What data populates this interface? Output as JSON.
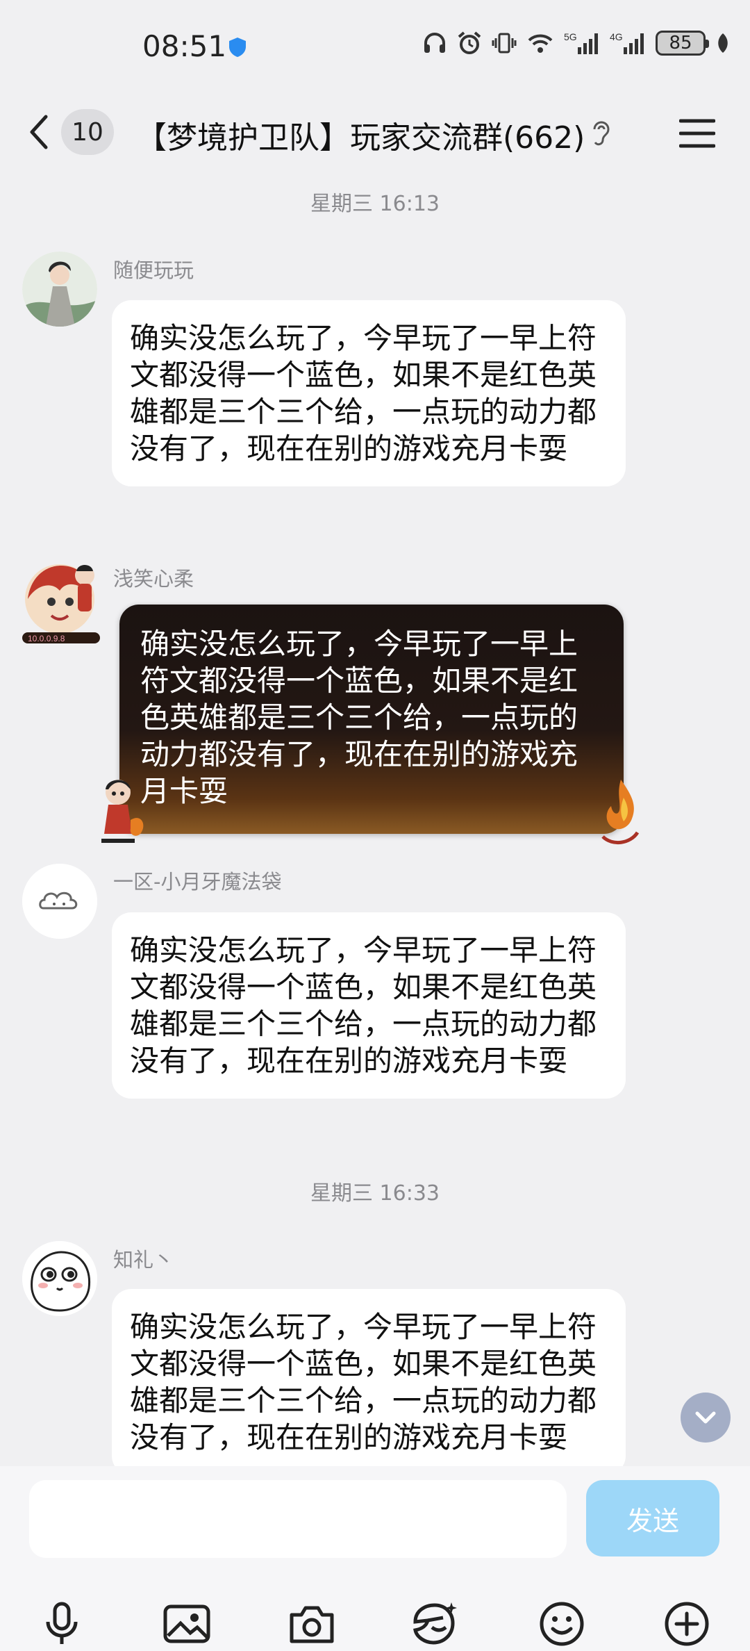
{
  "status": {
    "time": "08:51",
    "battery": "85"
  },
  "header": {
    "unread_count": "10",
    "title": "【梦境护卫队】玩家交流群(662)"
  },
  "timestamps": [
    "星期三 16:13",
    "星期三 16:33"
  ],
  "messages": [
    {
      "sender": "随便玩玩",
      "text": "确实没怎么玩了，今早玩了一早上符文都没得一个蓝色，如果不是红色英雄都是三个三个给，一点玩的动力都没有了，现在在别的游戏充月卡耍"
    },
    {
      "sender": "浅笑心柔",
      "text": "确实没怎么玩了，今早玩了一早上符文都没得一个蓝色，如果不是红色英雄都是三个三个给，一点玩的动力都没有了，现在在别的游戏充月卡耍"
    },
    {
      "sender": "一区-小月牙魔法袋",
      "text": "确实没怎么玩了，今早玩了一早上符文都没得一个蓝色，如果不是红色英雄都是三个三个给，一点玩的动力都没有了，现在在别的游戏充月卡耍"
    },
    {
      "sender": "知礼丶",
      "text": "确实没怎么玩了，今早玩了一早上符文都没得一个蓝色，如果不是红色英雄都是三个三个给，一点玩的动力都没有了，现在在别的游戏充月卡耍"
    }
  ],
  "input": {
    "value": "",
    "send_label": "发送"
  },
  "toolbar": [
    "microphone-icon",
    "image-icon",
    "camera-icon",
    "sticker-icon",
    "emoji-icon",
    "plus-icon"
  ],
  "colors": {
    "send_button": "#9dd7f8",
    "background": "#f0f0f2",
    "bubble": "#ffffff"
  }
}
